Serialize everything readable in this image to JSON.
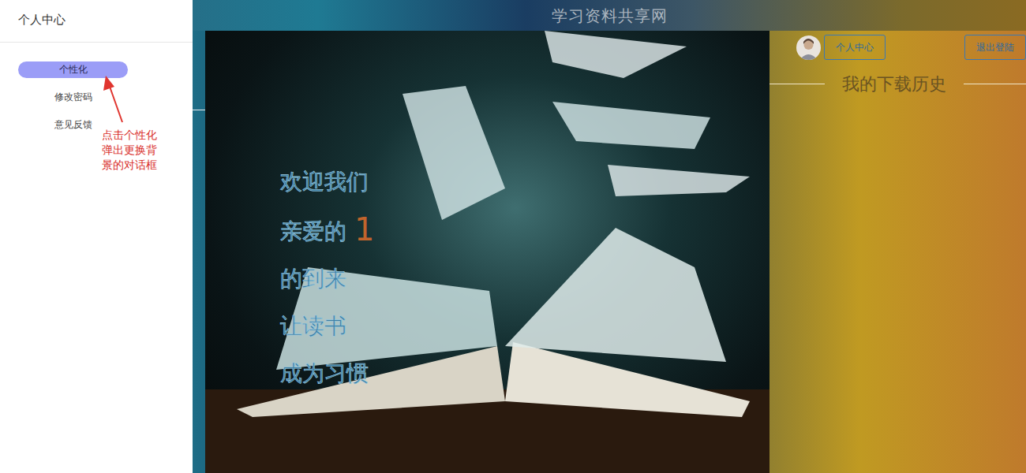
{
  "sidebar": {
    "title": "个人中心",
    "items": [
      {
        "label": "个性化",
        "selected": true
      },
      {
        "label": "修改密码",
        "selected": false
      },
      {
        "label": "意见反馈",
        "selected": false
      }
    ]
  },
  "annotation": {
    "text": "点击个性化弹出更换背景的对话框"
  },
  "site_title": "学习资料共享网",
  "welcome": {
    "line1": "欢迎我们",
    "line2_prefix": "亲爱的",
    "username": "1",
    "lines_after": [
      "的到来",
      "让读书",
      "成为习惯"
    ]
  },
  "header": {
    "profile_button": "个人中心",
    "logout_button": "退出登陆"
  },
  "download_history": {
    "title": "我的下载历史"
  }
}
